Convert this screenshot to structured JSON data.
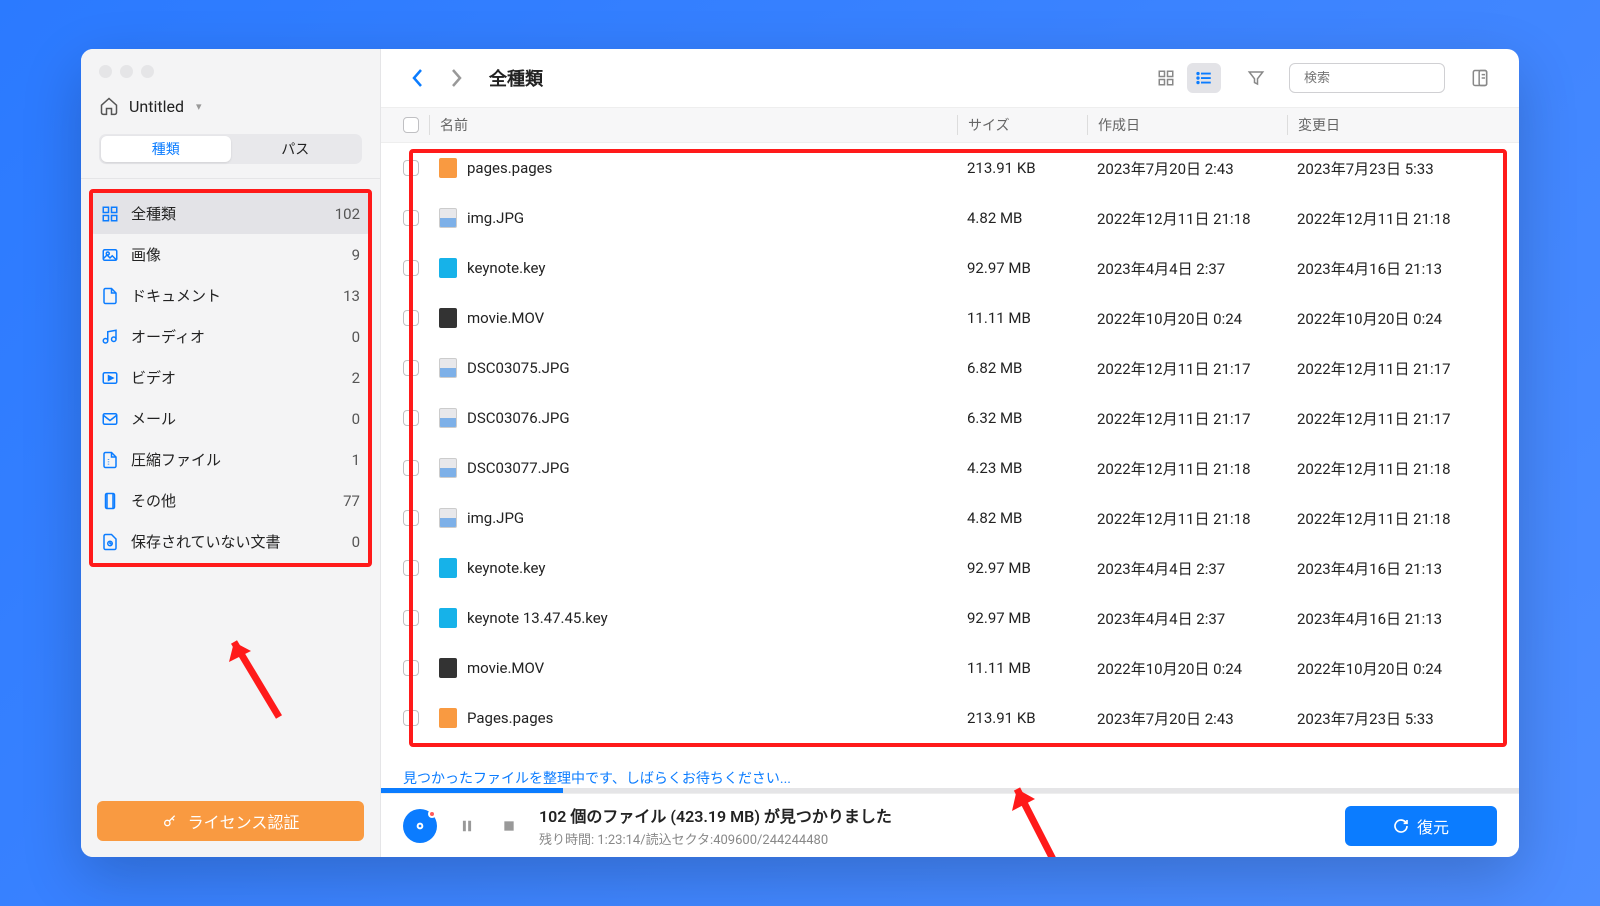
{
  "breadcrumb": {
    "title": "Untitled"
  },
  "segmented": {
    "type": "種類",
    "path": "パス"
  },
  "categories": [
    {
      "label": "全種類",
      "count": "102",
      "icon": "grid",
      "active": true
    },
    {
      "label": "画像",
      "count": "9",
      "icon": "image"
    },
    {
      "label": "ドキュメント",
      "count": "13",
      "icon": "doc"
    },
    {
      "label": "オーディオ",
      "count": "0",
      "icon": "audio"
    },
    {
      "label": "ビデオ",
      "count": "2",
      "icon": "video"
    },
    {
      "label": "メール",
      "count": "0",
      "icon": "mail"
    },
    {
      "label": "圧縮ファイル",
      "count": "1",
      "icon": "zip"
    },
    {
      "label": "その他",
      "count": "77",
      "icon": "other"
    },
    {
      "label": "保存されていない文書",
      "count": "0",
      "icon": "unsaved"
    }
  ],
  "license": {
    "label": "ライセンス認証"
  },
  "toolbar": {
    "title": "全種類"
  },
  "search": {
    "placeholder": "検索"
  },
  "columns": {
    "name": "名前",
    "size": "サイズ",
    "created": "作成日",
    "modified": "変更日"
  },
  "files": [
    {
      "name": "pages.pages",
      "size": "213.91 KB",
      "created": "2023年7月20日 2:43",
      "modified": "2023年7月23日 5:33",
      "icon": "pages"
    },
    {
      "name": "img.JPG",
      "size": "4.82 MB",
      "created": "2022年12月11日 21:18",
      "modified": "2022年12月11日 21:18",
      "icon": "img"
    },
    {
      "name": "keynote.key",
      "size": "92.97 MB",
      "created": "2023年4月4日 2:37",
      "modified": "2023年4月16日 21:13",
      "icon": "key"
    },
    {
      "name": "movie.MOV",
      "size": "11.11 MB",
      "created": "2022年10月20日 0:24",
      "modified": "2022年10月20日 0:24",
      "icon": "mov"
    },
    {
      "name": "DSC03075.JPG",
      "size": "6.82 MB",
      "created": "2022年12月11日 21:17",
      "modified": "2022年12月11日 21:17",
      "icon": "img"
    },
    {
      "name": "DSC03076.JPG",
      "size": "6.32 MB",
      "created": "2022年12月11日 21:17",
      "modified": "2022年12月11日 21:17",
      "icon": "img"
    },
    {
      "name": "DSC03077.JPG",
      "size": "4.23 MB",
      "created": "2022年12月11日 21:18",
      "modified": "2022年12月11日 21:18",
      "icon": "img"
    },
    {
      "name": "img.JPG",
      "size": "4.82 MB",
      "created": "2022年12月11日 21:18",
      "modified": "2022年12月11日 21:18",
      "icon": "img"
    },
    {
      "name": "keynote.key",
      "size": "92.97 MB",
      "created": "2023年4月4日 2:37",
      "modified": "2023年4月16日 21:13",
      "icon": "key"
    },
    {
      "name": "keynote 13.47.45.key",
      "size": "92.97 MB",
      "created": "2023年4月4日 2:37",
      "modified": "2023年4月16日 21:13",
      "icon": "key"
    },
    {
      "name": "movie.MOV",
      "size": "11.11 MB",
      "created": "2022年10月20日 0:24",
      "modified": "2022年10月20日 0:24",
      "icon": "mov"
    },
    {
      "name": "Pages.pages",
      "size": "213.91 KB",
      "created": "2023年7月20日 2:43",
      "modified": "2023年7月23日 5:33",
      "icon": "pages"
    }
  ],
  "status": {
    "organizing": "見つかったファイルを整理中です、しばらくお待ちください..."
  },
  "bottom": {
    "found": "102 個のファイル (423.19 MB) が見つかりました",
    "remaining": "残り時間: 1:23:14/読込セクタ:409600/244244480",
    "recover": "復元"
  },
  "progress": {
    "percent": 16
  }
}
